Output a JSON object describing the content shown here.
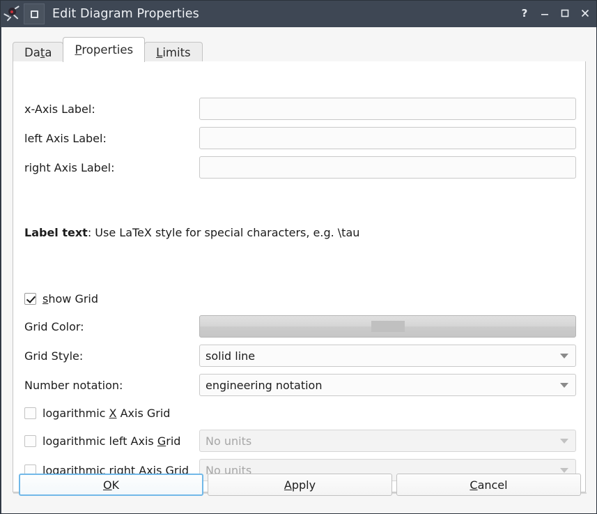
{
  "window": {
    "title": "Edit Diagram Properties",
    "icon": "application-icon",
    "menu_button": "window-menu-icon",
    "controls": [
      {
        "name": "help-button",
        "glyph": "?"
      },
      {
        "name": "minimize-button",
        "glyph": "—"
      },
      {
        "name": "maximize-button",
        "glyph": "□"
      },
      {
        "name": "close-button",
        "glyph": "✕"
      }
    ]
  },
  "tabs": [
    {
      "label": "Data",
      "mnemonic": "t",
      "active": false
    },
    {
      "label": "Properties",
      "mnemonic": "P",
      "active": true
    },
    {
      "label": "Limits",
      "mnemonic": "L",
      "active": false
    }
  ],
  "form": {
    "x_axis_label": {
      "label": "x-Axis Label:",
      "value": "",
      "placeholder": ""
    },
    "left_axis_label": {
      "label": "left Axis Label:",
      "value": "",
      "placeholder": ""
    },
    "right_axis_label": {
      "label": "right Axis Label:",
      "value": "",
      "placeholder": ""
    },
    "hint": {
      "bold": "Label text",
      "rest": ": Use LaTeX style for special characters, e.g. \\tau"
    },
    "show_grid": {
      "label_pre": "",
      "mnemonic": "s",
      "label_post": "how Grid",
      "checked": true
    },
    "grid_color": {
      "label": "Grid Color:",
      "swatch_color": "#c0c0c0"
    },
    "grid_style": {
      "label": "Grid Style:",
      "value": "solid line"
    },
    "number_notation": {
      "label": "Number notation:",
      "value": "engineering notation"
    },
    "log_x_axis": {
      "label_pre": "logarithmic ",
      "mnemonic": "X",
      "label_post": " Axis Grid",
      "checked": false
    },
    "log_left_axis": {
      "label_pre": "logarithmic left Axis ",
      "mnemonic": "G",
      "label_post": "rid",
      "checked": false,
      "units": {
        "value": "No units",
        "disabled": true
      }
    },
    "log_right_axis": {
      "label_pre": "logarithmic ",
      "mnemonic": "r",
      "label_post": "ight Axis Grid",
      "checked": false,
      "units": {
        "value": "No units",
        "disabled": true
      }
    }
  },
  "buttons": {
    "ok": {
      "pre": "",
      "mnemonic": "O",
      "post": "K"
    },
    "apply": {
      "pre": "",
      "mnemonic": "A",
      "post": "pply"
    },
    "cancel": {
      "pre": "",
      "mnemonic": "C",
      "post": "ancel"
    }
  },
  "colors": {
    "titlebar": "#3e4754",
    "panel": "#ffffff",
    "dialog_bg": "#f6f6f6",
    "focus_accent": "#71b8e8"
  }
}
